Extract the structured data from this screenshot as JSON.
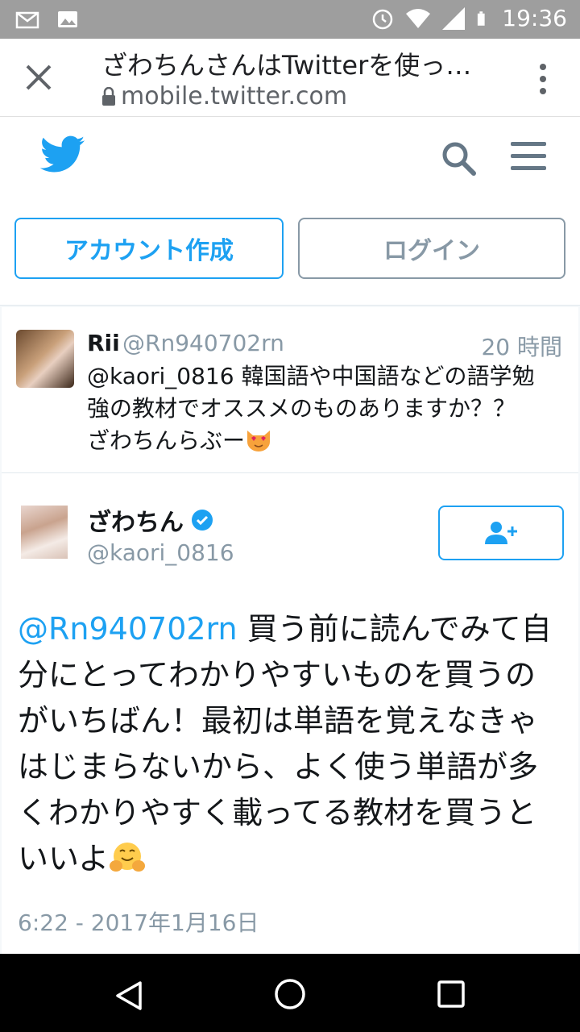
{
  "status_bar": {
    "time": "19:36",
    "icons": [
      "mail-icon",
      "image-icon",
      "alarm-icon",
      "wifi-icon",
      "signal-icon",
      "battery-icon"
    ]
  },
  "browser": {
    "title": "ざわちんさんはTwitterを使っ…",
    "url": "mobile.twitter.com"
  },
  "header": {
    "icons": [
      "twitter-bird-icon",
      "search-icon",
      "hamburger-menu-icon"
    ]
  },
  "buttons": {
    "signup": "アカウント作成",
    "login": "ログイン"
  },
  "reply_tweet": {
    "name": "Rii",
    "handle": "@Rn940702rn",
    "time": "20 時間",
    "mention": "@kaori_0816",
    "text_line1": " 韓国語や中国語などの語学勉",
    "text_line2": "強の教材でオススメのものありますか？？",
    "text_line3": "ざわちんらぶー"
  },
  "main_tweet": {
    "name": "ざわちん",
    "handle": "@kaori_0816",
    "mention": "@Rn940702rn",
    "text": " 買う前に読んでみて自分にとってわかりやすいものを買うのがいちばん！最初は単語を覚えなきゃはじまらないから、よく使う単語が多くわかりやすく載ってる教材を買うといいよ",
    "timestamp": "6:22 - 2017年1月16日"
  },
  "colors": {
    "twitter_blue": "#1da1f2",
    "gray_text": "#8899a6",
    "status_bar": "#9e9e9e"
  }
}
